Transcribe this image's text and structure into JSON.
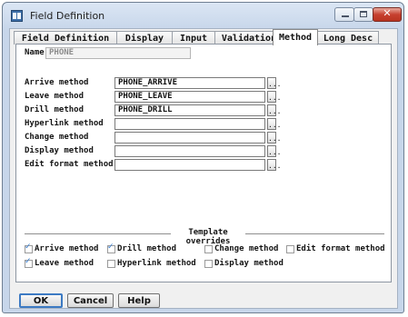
{
  "window": {
    "title": "Field Definition"
  },
  "tabs": [
    {
      "label": "Field Definition"
    },
    {
      "label": "Display"
    },
    {
      "label": "Input"
    },
    {
      "label": "Validation"
    },
    {
      "label": "Method"
    },
    {
      "label": "Long Desc"
    }
  ],
  "active_tab": "Method",
  "name": {
    "label": "Name",
    "value": "PHONE"
  },
  "methods": [
    {
      "label": "Arrive method",
      "value": "PHONE_ARRIVE",
      "browse": "..."
    },
    {
      "label": "Leave method",
      "value": "PHONE_LEAVE",
      "browse": "..."
    },
    {
      "label": "Drill method",
      "value": "PHONE_DRILL",
      "browse": "..."
    },
    {
      "label": "Hyperlink method",
      "value": "",
      "browse": "..."
    },
    {
      "label": "Change method",
      "value": "",
      "browse": "..."
    },
    {
      "label": "Display method",
      "value": "",
      "browse": "..."
    },
    {
      "label": "Edit format method",
      "value": "",
      "browse": "..."
    }
  ],
  "overrides": {
    "title": "Template overrides",
    "items": [
      {
        "label": "Arrive method",
        "checked": true
      },
      {
        "label": "Drill method",
        "checked": true
      },
      {
        "label": "Change method",
        "checked": false
      },
      {
        "label": "Edit format method",
        "checked": false
      },
      {
        "label": "Leave method",
        "checked": true
      },
      {
        "label": "Hyperlink method",
        "checked": false
      },
      {
        "label": "Display method",
        "checked": false
      }
    ]
  },
  "buttons": {
    "ok": "OK",
    "cancel": "Cancel",
    "help": "Help"
  },
  "icons": {
    "app": "form-icon",
    "check": "✓",
    "close": "✕"
  },
  "colors": {
    "accent": "#3c7ac3",
    "close": "#c7402f"
  }
}
